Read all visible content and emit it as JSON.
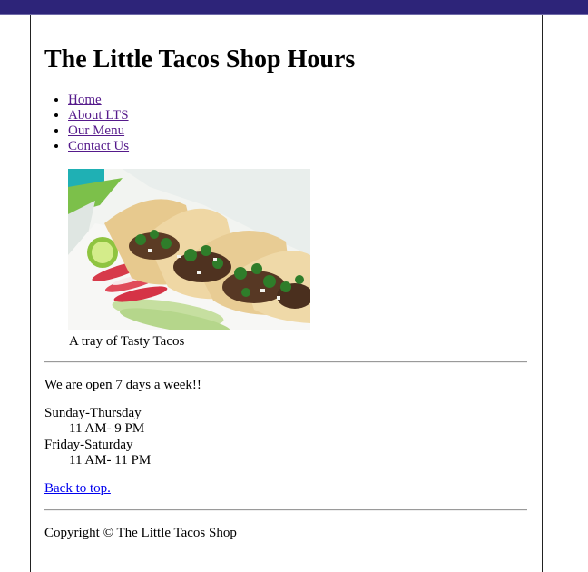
{
  "page": {
    "title": "The Little Tacos Shop Hours",
    "nav": [
      {
        "label": "Home"
      },
      {
        "label": "About LTS"
      },
      {
        "label": "Our Menu"
      },
      {
        "label": "Contact Us"
      }
    ],
    "figure": {
      "caption": "A tray of Tasty Tacos"
    },
    "hours": {
      "intro": "We are open 7 days a week!!",
      "weekday_label": "Sunday-Thursday",
      "weekday_hours": "11 AM- 9 PM",
      "weekend_label": "Friday-Saturday",
      "weekend_hours": "11 AM- 11 PM"
    },
    "back_to_top": "Back to top.",
    "footer": "Copyright © The Little Tacos Shop"
  },
  "colors": {
    "header_bar": "#2d2479",
    "visited_link": "#551a8b",
    "link": "#0000ee"
  }
}
